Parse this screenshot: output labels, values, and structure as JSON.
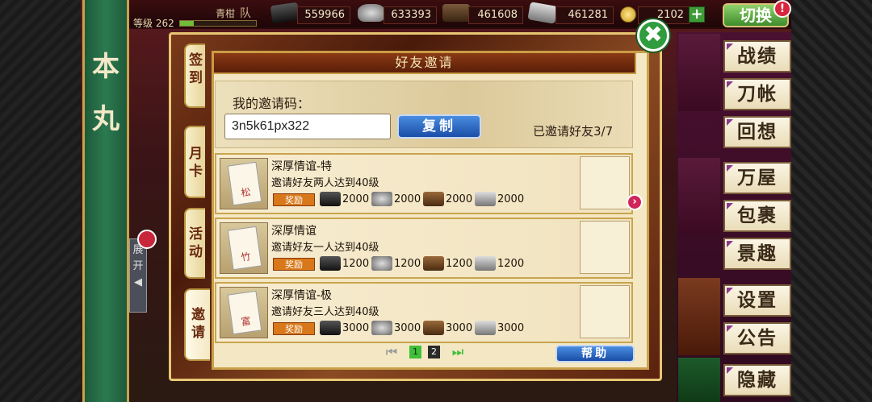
{
  "topbar": {
    "player_name": "青柑",
    "team_label": "队",
    "level_label": "等级 262",
    "level_progress": 0.18,
    "resources": [
      {
        "icon": "charcoal-icon",
        "value": "559966"
      },
      {
        "icon": "steel-icon",
        "value": "633393"
      },
      {
        "icon": "cooling-material-icon",
        "value": "461608"
      },
      {
        "icon": "whetstone-icon",
        "value": "461281"
      }
    ],
    "koban": "2102",
    "plus": "+",
    "switch_label": "切换",
    "alert_label": "!"
  },
  "banner": {
    "chars": [
      "本",
      "丸"
    ]
  },
  "expand": {
    "chars": [
      "展",
      "开"
    ],
    "arrow": "◀"
  },
  "menu": {
    "items": [
      "战绩",
      "刀帐",
      "回想",
      "万屋",
      "包裹",
      "景趣",
      "设置",
      "公告",
      "隐藏"
    ]
  },
  "dialog": {
    "title": "好友邀请",
    "close": "✖",
    "tabs": [
      {
        "label": "签到"
      },
      {
        "label": "月卡"
      },
      {
        "label": "活动"
      },
      {
        "label": "邀请"
      }
    ],
    "code_label": "我的邀请码：",
    "code_value": "3n5k61px322",
    "copy_label": "复制",
    "invited_text": "已邀请好友3/7",
    "reward_label": "奖励",
    "quests": [
      {
        "title": "深厚情谊-特",
        "desc": "邀请好友两人达到40级",
        "badge": "松",
        "rewards": [
          "2000",
          "2000",
          "2000",
          "2000"
        ]
      },
      {
        "title": "深厚情谊",
        "desc": "邀请好友一人达到40级",
        "badge": "竹",
        "rewards": [
          "1200",
          "1200",
          "1200",
          "1200"
        ]
      },
      {
        "title": "深厚情谊-极",
        "desc": "邀请好友三人达到40级",
        "badge": "富",
        "rewards": [
          "3000",
          "3000",
          "3000",
          "3000"
        ]
      }
    ],
    "pager": {
      "pages": [
        "1",
        "2"
      ],
      "current": "1"
    },
    "help_label": "帮助",
    "next_arrow": "›"
  },
  "colors": {
    "accent_green": "#2f9c3e",
    "button_blue": "#1a4ea8",
    "reward_orange": "#d8781a",
    "frame_gold": "#c9a04a"
  }
}
